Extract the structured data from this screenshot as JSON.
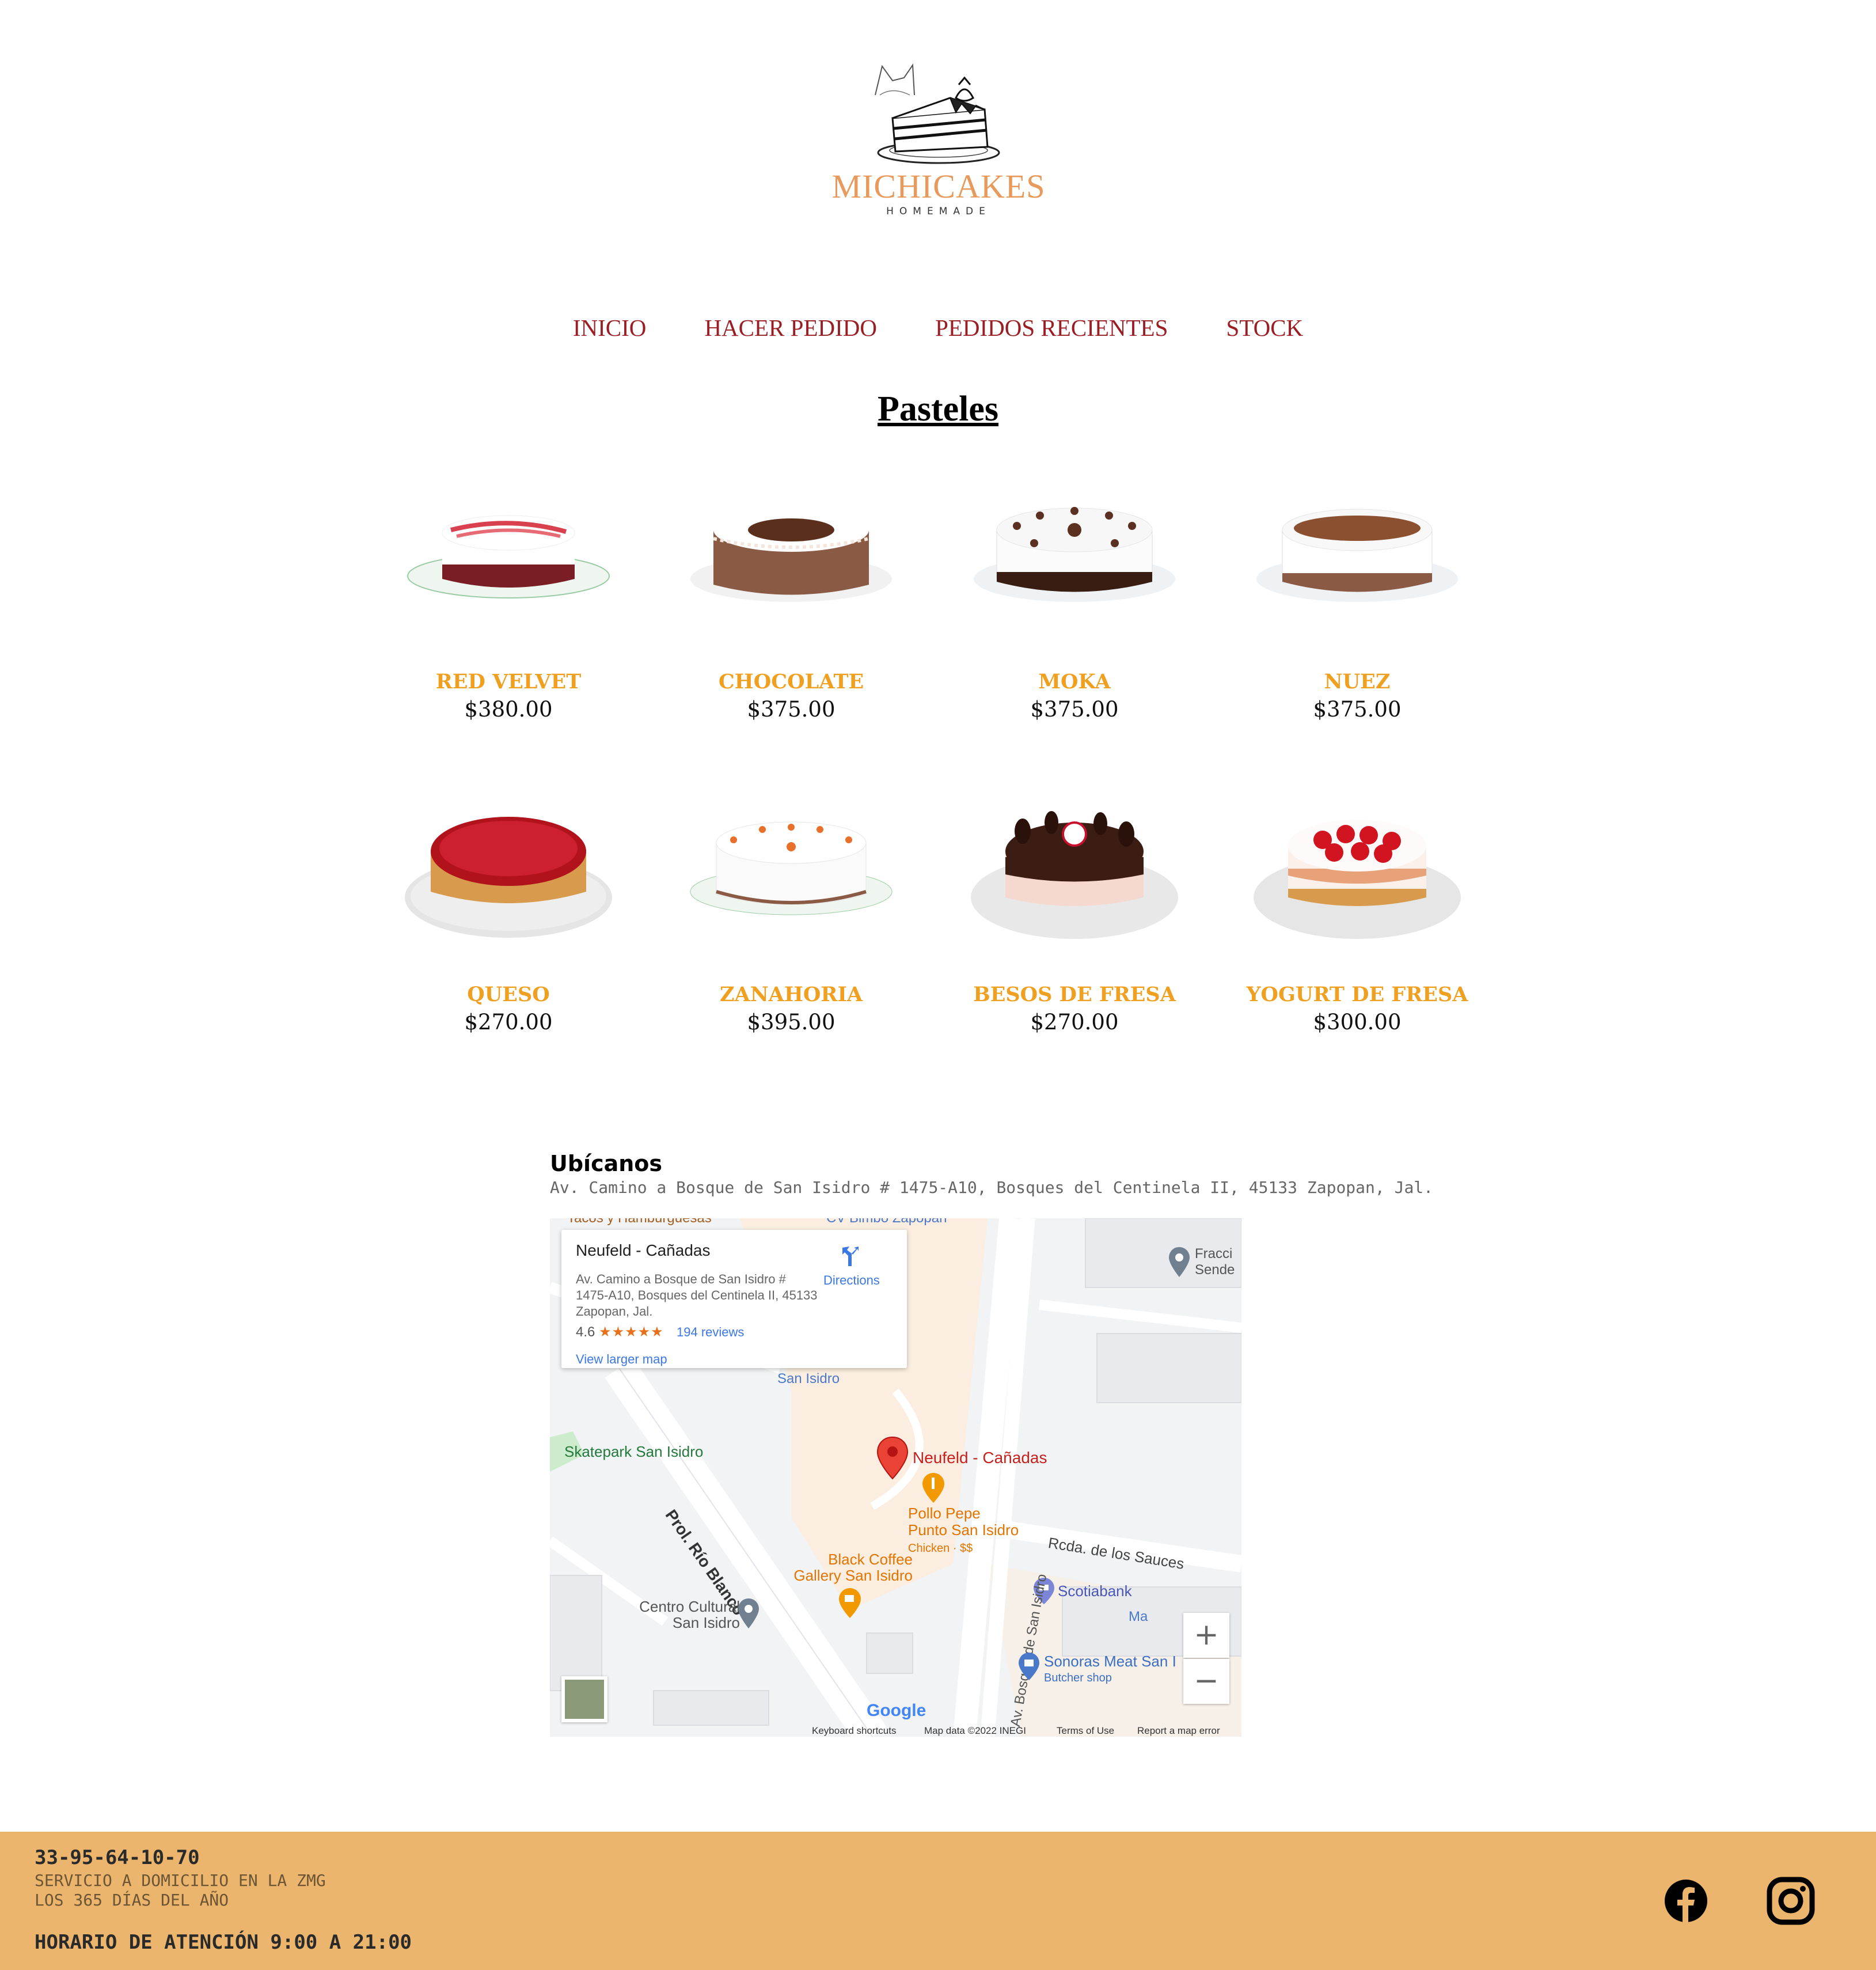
{
  "brand": {
    "name": "MICHICAKES",
    "tagline": "HOMEMADE"
  },
  "nav": [
    "INICIO",
    "HACER PEDIDO",
    "PEDIDOS RECIENTES",
    "STOCK"
  ],
  "page_title": "Pasteles",
  "products": [
    {
      "name": "RED VELVET",
      "price": "$380.00",
      "style": "redvelvet"
    },
    {
      "name": "CHOCOLATE",
      "price": "$375.00",
      "style": "chocolate"
    },
    {
      "name": "MOKA",
      "price": "$375.00",
      "style": "moka"
    },
    {
      "name": "NUEZ",
      "price": "$375.00",
      "style": "nuez"
    },
    {
      "name": "QUESO",
      "price": "$270.00",
      "style": "queso"
    },
    {
      "name": "ZANAHORIA",
      "price": "$395.00",
      "style": "zanahoria"
    },
    {
      "name": "BESOS DE FRESA",
      "price": "$270.00",
      "style": "besos"
    },
    {
      "name": "YOGURT DE FRESA",
      "price": "$300.00",
      "style": "yogurt"
    }
  ],
  "location": {
    "title": "Ubícanos",
    "address": "Av. Camino a Bosque de San Isidro # 1475-A10, Bosques del Centinela II, 45133 Zapopan, Jal."
  },
  "map": {
    "card_name": "Neufeld - Cañadas",
    "card_address": "Av. Camino a Bosque de San Isidro # 1475-A10, Bosques del Centinela II, 45133 Zapopan, Jal.",
    "rating": "4.6",
    "stars": "★★★★★",
    "reviews": "194 reviews",
    "directions": "Directions",
    "view_larger": "View larger map",
    "labels": {
      "skatepark": "Skatepark San Isidro",
      "rio_blanco": "Prol. Río Blanco",
      "pin": "Neufeld - Cañadas",
      "pollo1": "Pollo Pepe",
      "pollo2": "Punto San Isidro",
      "pollo3": "Chicken · $$",
      "coffee1": "Black Coffee",
      "coffee2": "Gallery San Isidro",
      "centro1": "Centro Cultural",
      "centro2": "San Isidro",
      "sauces": "Rcda. de los Sauces",
      "scotia": "Scotiabank",
      "sonoras1": "Sonoras Meat San I",
      "sonoras2": "Butcher shop",
      "bosque": "Av. Bosque de San Isidro",
      "fracc1": "Fracci",
      "fracc2": "Sende",
      "sanisidro": "San Isidro",
      "ma": "Ma",
      "tacos": "Tacos y Hamburguesas",
      "bimbo": "CV Bimbo Zapopan",
      "google": "Google"
    },
    "zoom_in": "+",
    "zoom_out": "−",
    "footer": {
      "shortcuts": "Keyboard shortcuts",
      "mapdata": "Map data ©2022 INEGI",
      "terms": "Terms of Use",
      "report": "Report a map error"
    }
  },
  "footer": {
    "phone": "33-95-64-10-70",
    "service_line1": "SERVICIO A DOMICILIO EN LA ZMG",
    "service_line2": "LOS 365 DÍAS DEL AÑO",
    "hours": "HORARIO DE ATENCIÓN 9:00 A 21:00",
    "social": [
      "facebook-icon",
      "instagram-icon"
    ]
  },
  "colors": {
    "nav": "#9a1f24",
    "product_name": "#f0a020",
    "brand": "#e89a5c",
    "footer_bg": "#ecb56d"
  }
}
